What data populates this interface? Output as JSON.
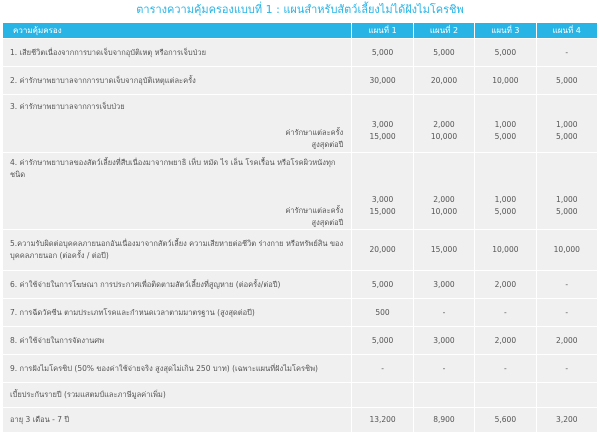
{
  "title": "ตารางความคุ้มครองแบบที่ 1 : แผนสำหรับสัตว์เลี้ยงไม่ได้ฝังไมโครชิพ",
  "header": {
    "coverage": "ความคุ้มครอง",
    "plans": [
      "แผนที่ 1",
      "แผนที่ 2",
      "แผนที่ 3",
      "แผนที่ 4"
    ]
  },
  "rows": {
    "r1": {
      "label": "1. เสียชีวิตเนื่องจากการบาดเจ็บจากอุบัติเหตุ หรือการเจ็บป่วย",
      "v": [
        "5,000",
        "5,000",
        "5,000",
        "-"
      ]
    },
    "r2": {
      "label": "2. ค่ารักษาพยาบาลจากการบาดเจ็บจากอุบัติเหตุแต่ละครั้ง",
      "v": [
        "30,000",
        "20,000",
        "10,000",
        "5,000"
      ]
    },
    "r3": {
      "label": "3. ค่ารักษาพยาบาลจากการเจ็บป่วย",
      "sub1": "ค่ารักษาแต่ละครั้ง",
      "sub2": "สูงสุดต่อปี",
      "v1": [
        "3,000",
        "2,000",
        "1,000",
        "1,000"
      ],
      "v2": [
        "15,000",
        "10,000",
        "5,000",
        "5,000"
      ]
    },
    "r4": {
      "label": "4. ค่ารักษาพยาบาลของสัตว์เลี้ยงที่สืบเนื่องมาจากพยาธิ เห็บ หมัด ไร เล็น โรคเรื้อน หรือโรคผิวหนังทุกชนิด",
      "sub1": "ค่ารักษาแต่ละครั้ง",
      "sub2": "สูงสุดต่อปี",
      "v1": [
        "3,000",
        "2,000",
        "1,000",
        "1,000"
      ],
      "v2": [
        "15,000",
        "10,000",
        "5,000",
        "5,000"
      ]
    },
    "r5": {
      "label": "5.ความรับผิดต่อบุคคลภายนอกอันเนื่องมาจากสัตว์เลี้ยง ความเสียหายต่อชีวิต ร่างกาย หรือทรัพย์สิน ของบุคคลภายนอก (ต่อครั้ง / ต่อปี)",
      "v": [
        "20,000",
        "15,000",
        "10,000",
        "10,000"
      ]
    },
    "r6": {
      "label": "6. ค่าใช้จ่ายในการโฆษณา การประกาศเพื่อติดตามสัตว์เลี้ยงที่สูญหาย (ต่อครั้ง/ต่อปี)",
      "v": [
        "5,000",
        "3,000",
        "2,000",
        "-"
      ]
    },
    "r7": {
      "label": "7. การฉีดวัคซีน ตามประเภทโรคและกำหนดเวลาตามมาตรฐาน (สูงสุดต่อปี)",
      "v": [
        "500",
        "-",
        "-",
        "-"
      ]
    },
    "r8": {
      "label": "8. ค่าใช้จ่ายในการจัดงานศพ",
      "v": [
        "5,000",
        "3,000",
        "2,000",
        "2,000"
      ]
    },
    "r9": {
      "label": "9. การฝังไมโครชิป (50% ของค่าใช้จ่ายจริง สูงสุดไม่เกิน 250 บาท) (เฉพาะแผนที่ฝังไมโครชิพ)",
      "v": [
        "-",
        "-",
        "-",
        "-"
      ]
    },
    "premium_heading": "เบี้ยประกันรายปี (รวมแสตมป์และภาษีมูลค่าเพิ่ม)",
    "premium": {
      "label": "อายุ 3 เดือน - 7 ปี",
      "v": [
        "13,200",
        "8,900",
        "5,600",
        "3,200"
      ]
    }
  }
}
